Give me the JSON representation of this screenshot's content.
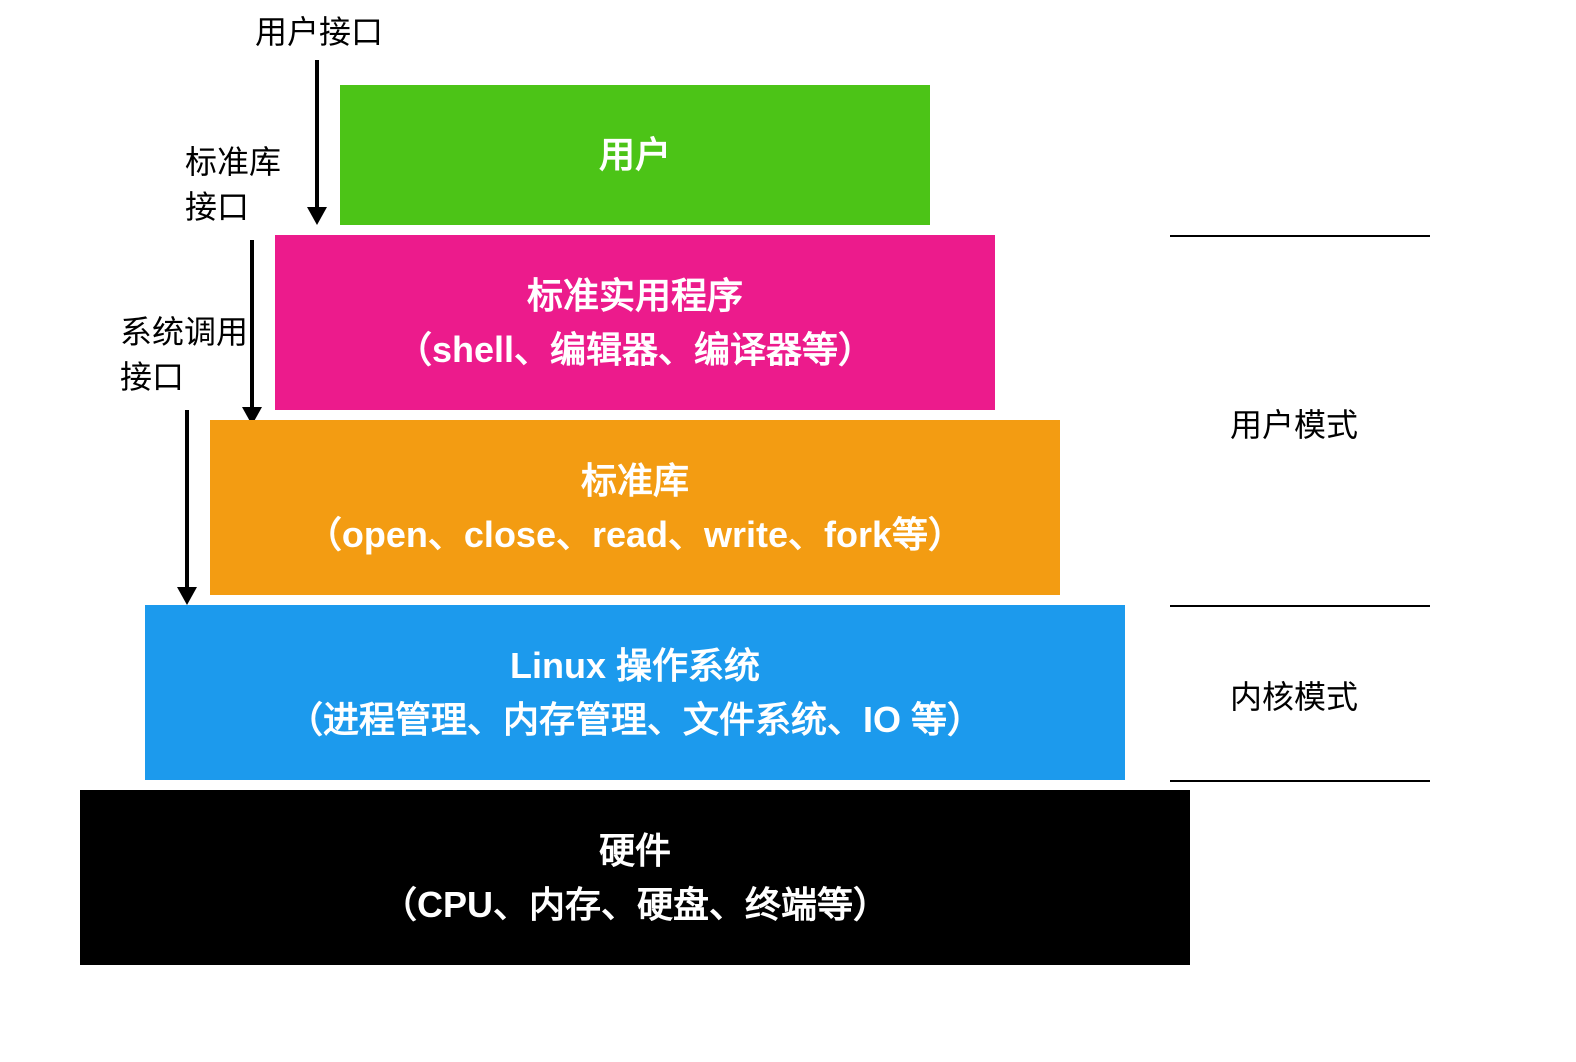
{
  "interfaces": {
    "user": "用户接口",
    "lib_line1": "标准库",
    "lib_line2": "接口",
    "syscall_line1": "系统调用",
    "syscall_line2": "接口"
  },
  "layers": {
    "user": {
      "title": "用户",
      "color": "#4CC417"
    },
    "utils": {
      "line1": "标准实用程序",
      "line2": "（shell、编辑器、编译器等）",
      "color": "#EC1B8C"
    },
    "lib": {
      "line1": "标准库",
      "line2": "（open、close、read、write、fork等）",
      "color": "#F39C12"
    },
    "os": {
      "line1": "Linux 操作系统",
      "line2": "（进程管理、内存管理、文件系统、IO 等）",
      "color": "#1C9AED"
    },
    "hw": {
      "line1": "硬件",
      "line2": "（CPU、内存、硬盘、终端等）",
      "color": "#000000"
    }
  },
  "modes": {
    "user": "用户模式",
    "kernel": "内核模式"
  }
}
